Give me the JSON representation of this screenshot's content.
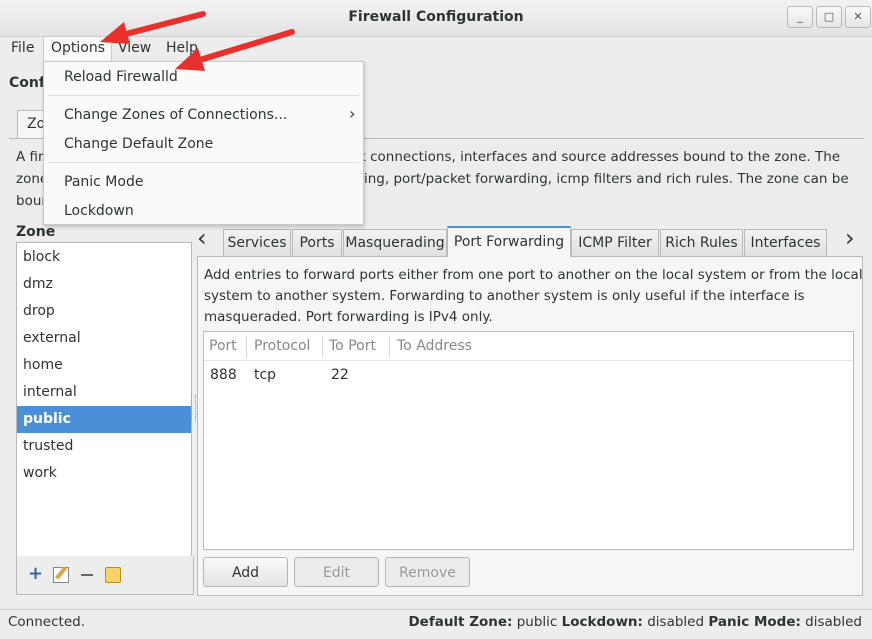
{
  "window": {
    "title": "Firewall Configuration"
  },
  "menubar": {
    "file": "File",
    "options": "Options",
    "view": "View",
    "help": "Help"
  },
  "options_menu": {
    "items": [
      "Reload Firewalld",
      "Change Zones of Connections...",
      "Change Default Zone",
      "Panic Mode",
      "Lockdown"
    ],
    "submenu_arrow": "›"
  },
  "config": {
    "label_partial": "Conf",
    "zone_tab_partial": "Zo"
  },
  "description": {
    "line1_left": "A fir",
    "line1_right": "k connections, interfaces and source addresses bound to the zone. The",
    "line2_left": "zone",
    "line2_right": "ing, port/packet forwarding, icmp filters and rich rules. The zone can be",
    "line3_left": "boun"
  },
  "zone_list": {
    "heading": "Zone",
    "items": [
      "block",
      "dmz",
      "drop",
      "external",
      "home",
      "internal",
      "public",
      "trusted",
      "work"
    ],
    "selected": "public"
  },
  "tabs": {
    "left_arrow": "‹",
    "right_arrow": "›",
    "items": [
      "Services",
      "Ports",
      "Masquerading",
      "Port Forwarding",
      "ICMP Filter",
      "Rich Rules",
      "Interfaces"
    ],
    "active": "Port Forwarding"
  },
  "port_forwarding": {
    "description_lines": [
      "Add entries to forward ports either from one port to another on the local system or from the local",
      "system to another system. Forwarding to another system is only useful if the interface is",
      "masqueraded. Port forwarding is IPv4 only."
    ],
    "columns": [
      "Port",
      "Protocol",
      "To Port",
      "To Address"
    ],
    "rows": [
      {
        "port": "888",
        "protocol": "tcp",
        "to_port": "22",
        "to_address": ""
      }
    ],
    "buttons": {
      "add": "Add",
      "edit": "Edit",
      "remove": "Remove"
    }
  },
  "status": {
    "left": "Connected.",
    "default_zone_label": "Default Zone:",
    "default_zone_value": "public",
    "lockdown_label": "Lockdown:",
    "lockdown_value": "disabled",
    "panic_label": "Panic Mode:",
    "panic_value": "disabled"
  },
  "colors": {
    "selection": "#4a90d9",
    "annotation_arrow": "#e8302c"
  }
}
